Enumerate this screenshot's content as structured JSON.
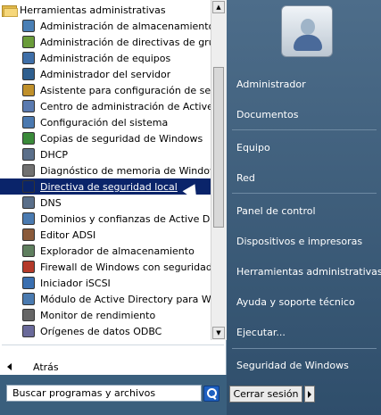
{
  "folder": {
    "label": "Herramientas administrativas"
  },
  "items": [
    {
      "label": "Administración de almacenamiento y rec",
      "icon": "storage-icon"
    },
    {
      "label": "Administración de directivas de grupo",
      "icon": "group-policy-icon"
    },
    {
      "label": "Administración de equipos",
      "icon": "computer-management-icon"
    },
    {
      "label": "Administrador del servidor",
      "icon": "server-manager-icon"
    },
    {
      "label": "Asistente para configuración de segurid",
      "icon": "security-wizard-icon"
    },
    {
      "label": "Centro de administración de Active Direc",
      "icon": "ad-admin-center-icon"
    },
    {
      "label": "Configuración del sistema",
      "icon": "system-config-icon"
    },
    {
      "label": "Copias de seguridad de Windows",
      "icon": "backup-icon"
    },
    {
      "label": "DHCP",
      "icon": "dhcp-icon"
    },
    {
      "label": "Diagnóstico de memoria de Windows",
      "icon": "memory-diagnostic-icon"
    },
    {
      "label": "Directiva de seguridad local",
      "icon": "local-security-policy-icon",
      "selected": true
    },
    {
      "label": "DNS",
      "icon": "dns-icon"
    },
    {
      "label": "Dominios y confianzas de Active Director",
      "icon": "domains-trusts-icon"
    },
    {
      "label": "Editor ADSI",
      "icon": "adsi-editor-icon"
    },
    {
      "label": "Explorador de almacenamiento",
      "icon": "storage-explorer-icon"
    },
    {
      "label": "Firewall de Windows con seguridad avar",
      "icon": "firewall-icon"
    },
    {
      "label": "Iniciador iSCSI",
      "icon": "iscsi-icon"
    },
    {
      "label": "Módulo de Active Directory para Window",
      "icon": "ad-module-icon"
    },
    {
      "label": "Monitor de rendimiento",
      "icon": "performance-monitor-icon"
    },
    {
      "label": "Orígenes de datos ODBC",
      "icon": "odbc-icon"
    }
  ],
  "back": {
    "label": "Atrás"
  },
  "search": {
    "placeholder": "Buscar programas y archivos"
  },
  "right": {
    "items": [
      {
        "label": "Administrador"
      },
      {
        "label": "Documentos"
      },
      {
        "label": "Equipo"
      },
      {
        "label": "Red"
      },
      {
        "label": "Panel de control"
      },
      {
        "label": "Dispositivos e impresoras"
      },
      {
        "label": "Herramientas administrativas"
      },
      {
        "label": "Ayuda y soporte técnico"
      },
      {
        "label": "Ejecutar..."
      },
      {
        "label": "Seguridad de Windows"
      }
    ]
  },
  "shutdown": {
    "label": "Cerrar sesión"
  },
  "colors": {
    "selection": "#0a246a",
    "right_panel": "#3f5f7c"
  }
}
